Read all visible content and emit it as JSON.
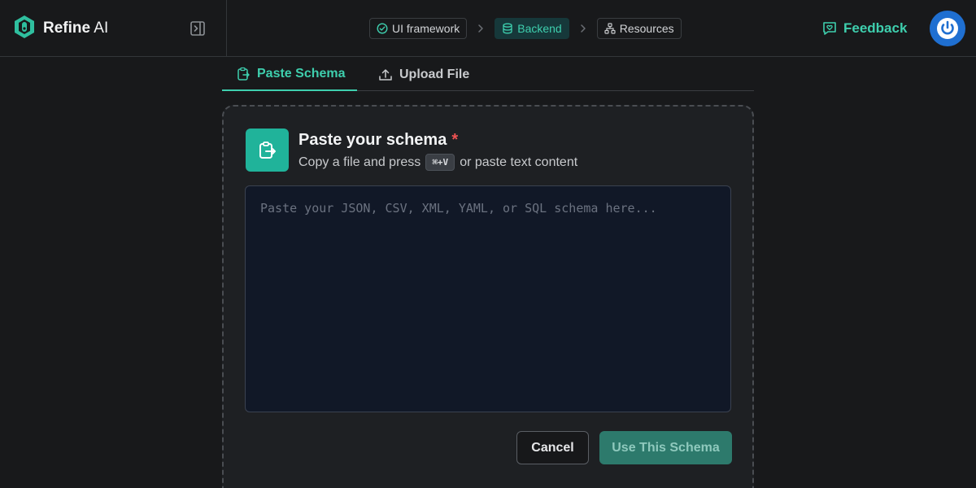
{
  "brand": {
    "name_bold": "Refine",
    "name_rest": " AI"
  },
  "breadcrumbs": [
    {
      "label": "UI framework",
      "icon": "check-circle-icon",
      "active": false
    },
    {
      "label": "Backend",
      "icon": "database-icon",
      "active": true
    },
    {
      "label": "Resources",
      "icon": "sitemap-icon",
      "active": false
    }
  ],
  "header": {
    "feedback_label": "Feedback"
  },
  "tabs": [
    {
      "label": "Paste Schema",
      "icon": "clipboard-icon",
      "active": true
    },
    {
      "label": "Upload File",
      "icon": "upload-icon",
      "active": false
    }
  ],
  "panel": {
    "title": "Paste your schema",
    "required_mark": "*",
    "subtitle_before": "Copy a file and press",
    "shortcut": "⌘+V",
    "subtitle_after": "or paste text content",
    "placeholder": "Paste your JSON, CSV, XML, YAML, or SQL schema here...",
    "value": ""
  },
  "actions": {
    "cancel_label": "Cancel",
    "use_label": "Use This Schema"
  },
  "colors": {
    "accent": "#3ecfae",
    "icon_bg": "#20b39a",
    "avatar": "#1f6fd1",
    "danger": "#f05252"
  }
}
